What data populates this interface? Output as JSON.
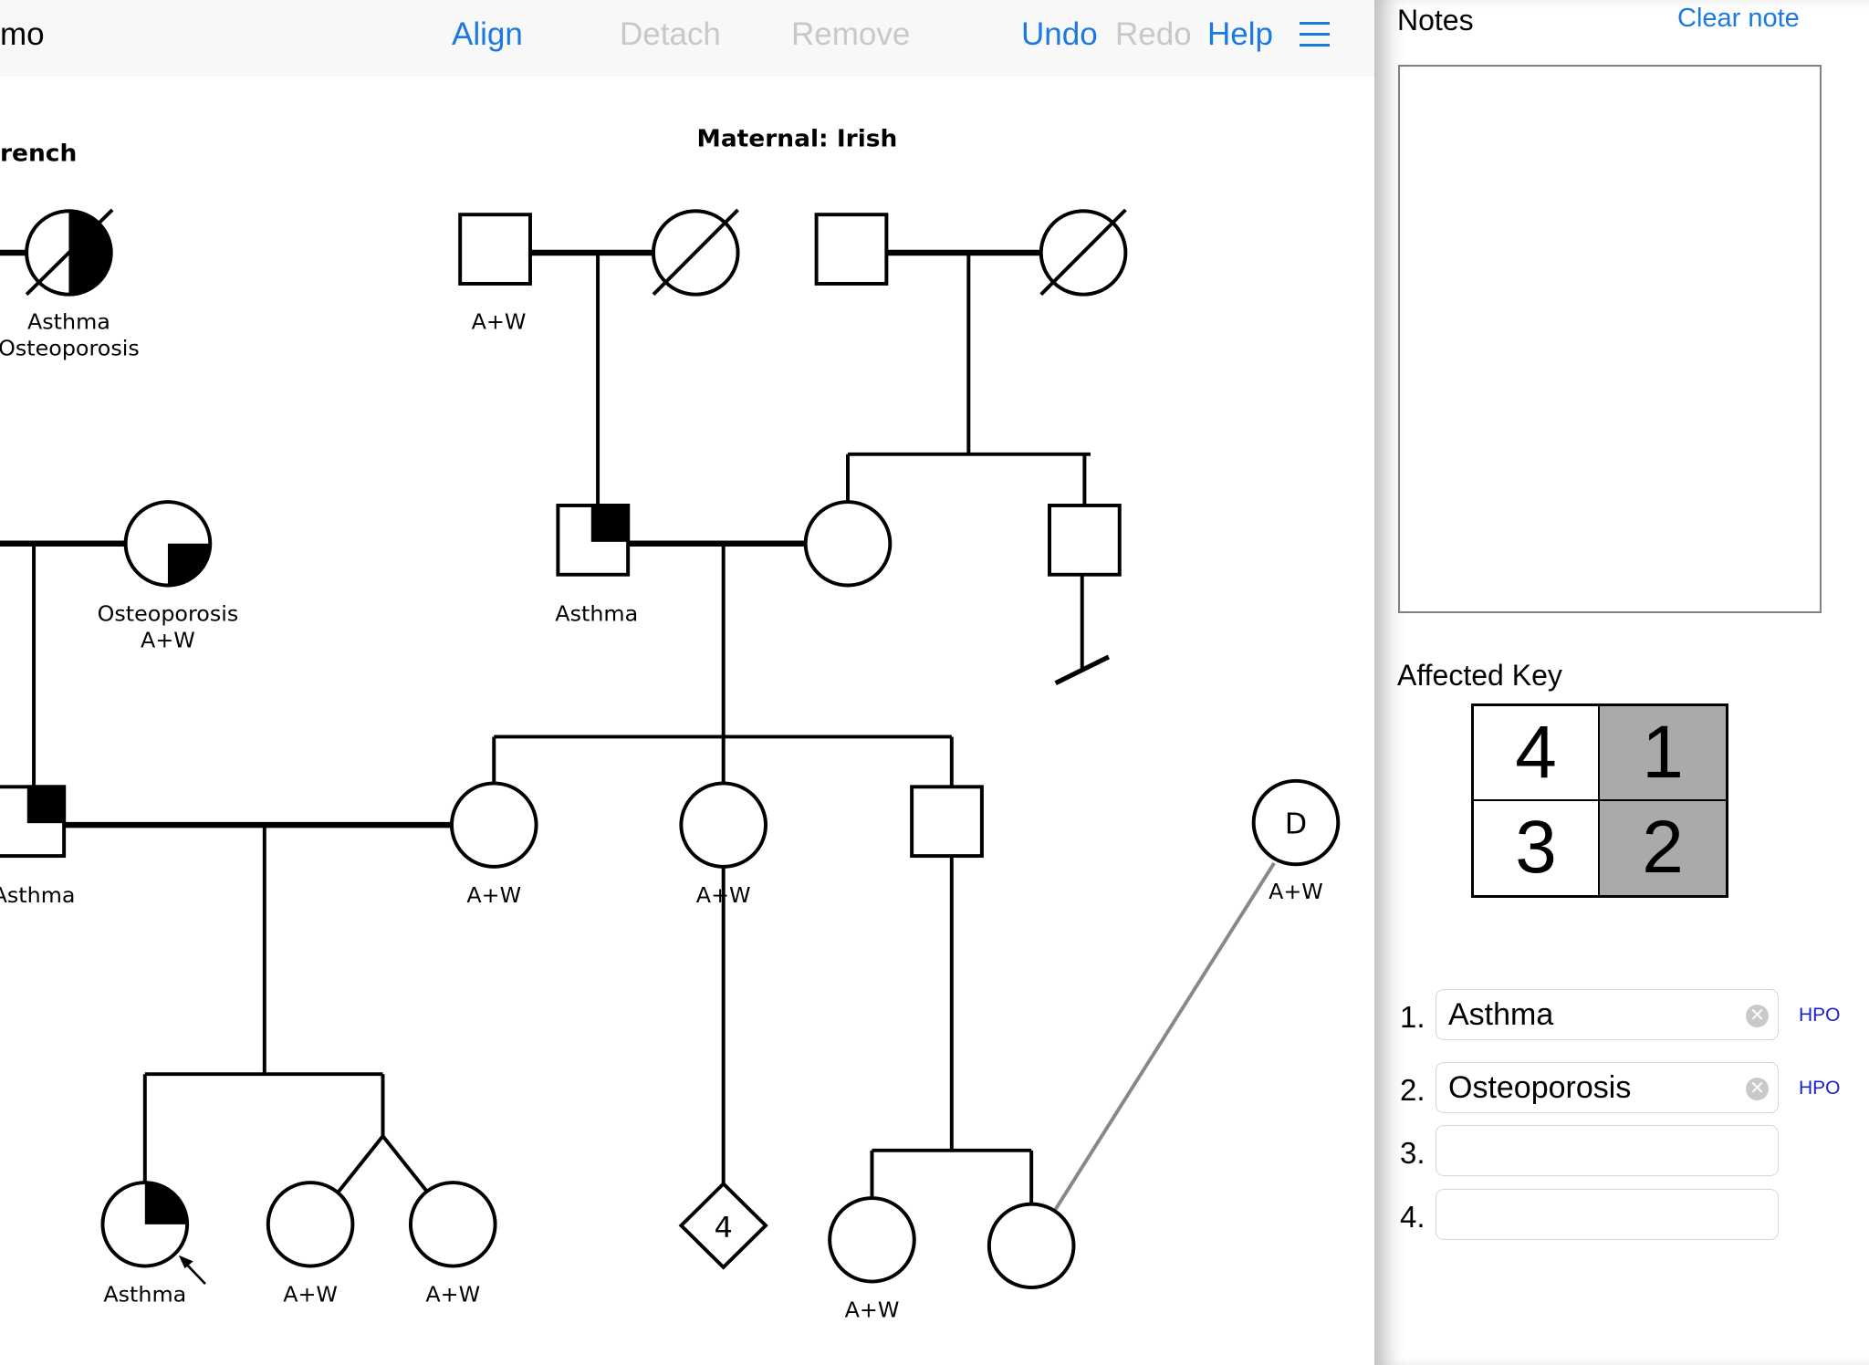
{
  "toolbar": {
    "title": "mo",
    "align": "Align",
    "detach": "Detach",
    "remove": "Remove",
    "undo": "Undo",
    "redo": "Redo",
    "help": "Help",
    "menu_icon": "hamburger-menu-icon"
  },
  "pedigree": {
    "paternal_heading": "rench",
    "maternal_heading": "Maternal: Irish",
    "labels": {
      "paternal_gm_line1": "Asthma",
      "paternal_gm_line2": "Osteoporosis",
      "maternal_ggf1": "A+W",
      "aunt_line1": "Osteoporosis",
      "aunt_line2": "A+W",
      "maternal_gf": "Asthma",
      "father": "Asthma",
      "mother": "A+W",
      "mat_aunt": "A+W",
      "donor": "A+W",
      "proband": "Asthma",
      "twin1": "A+W",
      "twin2": "A+W",
      "cousin1": "A+W"
    },
    "diamond_count": "4",
    "donor_mark": "D"
  },
  "notes": {
    "title": "Notes",
    "clear_label": "Clear note",
    "value": ""
  },
  "affected_key": {
    "title": "Affected Key",
    "cells": [
      "4",
      "1",
      "3",
      "2"
    ],
    "shaded_color": "#aaaaaa",
    "conditions": [
      {
        "num": "1.",
        "value": "Asthma",
        "hpo": "HPO"
      },
      {
        "num": "2.",
        "value": "Osteoporosis",
        "hpo": "HPO"
      },
      {
        "num": "3.",
        "value": "",
        "hpo": ""
      },
      {
        "num": "4.",
        "value": "",
        "hpo": ""
      }
    ]
  }
}
